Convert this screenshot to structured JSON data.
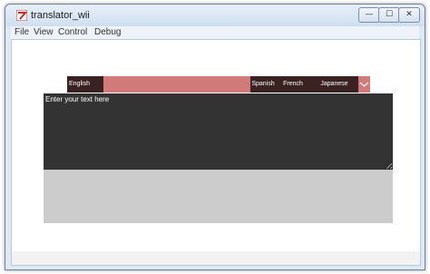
{
  "window": {
    "title": "translator_wii",
    "controls": {
      "minimize": "—",
      "maximize": "☐",
      "close": "✕"
    }
  },
  "menu": [
    "File",
    "View",
    "Control",
    "Debug"
  ],
  "language_bar": {
    "source": "English",
    "targets": [
      "Spanish",
      "French",
      "Japanese"
    ],
    "expand_icon": "chevron-down-icon"
  },
  "input": {
    "placeholder": "Enter your text here",
    "value": ""
  },
  "colors": {
    "lang_bar": "#d07a7a",
    "lang_button": "#3a2222",
    "input_bg": "#333333",
    "output_bg": "#cccccc"
  }
}
